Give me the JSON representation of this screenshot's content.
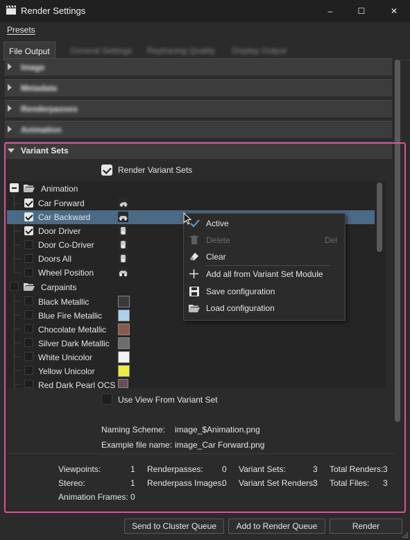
{
  "window": {
    "title": "Render Settings",
    "minimize": "–",
    "maximize": "☐",
    "close": "✕"
  },
  "menu": {
    "presets": "Presets"
  },
  "tabs": [
    "File Output",
    "General Settings",
    "Raytracing Quality",
    "Display Output"
  ],
  "sections": {
    "collapsed": [
      "Image",
      "Metadata",
      "Renderpasses",
      "Animation"
    ],
    "expanded": "Variant Sets"
  },
  "render_variant_sets": {
    "label": "Render Variant Sets",
    "checked": true
  },
  "tree": {
    "groups": [
      {
        "label": "Animation",
        "state": "partial",
        "items": [
          {
            "label": "Car Forward",
            "checked": true
          },
          {
            "label": "Car Backward",
            "checked": true,
            "selected": true
          },
          {
            "label": "Door Driver",
            "checked": true
          },
          {
            "label": "Door Co-Driver",
            "checked": false
          },
          {
            "label": "Doors All",
            "checked": false
          },
          {
            "label": "Wheel Position",
            "checked": false
          }
        ]
      },
      {
        "label": "Carpaints",
        "state": "unchecked",
        "items": [
          {
            "label": "Black Metallic",
            "checked": false,
            "swatch": "#3a3a3a"
          },
          {
            "label": "Blue Fire Metallic",
            "checked": false,
            "swatch": "#a9d2ea"
          },
          {
            "label": "Chocolate Metallic",
            "checked": false,
            "swatch": "#8a5a48"
          },
          {
            "label": "Silver Dark Metallic",
            "checked": false,
            "swatch": "#6d6d6d"
          },
          {
            "label": "White Unicolor",
            "checked": false,
            "swatch": "#f2f2f2"
          },
          {
            "label": "Yellow Unicolor",
            "checked": false,
            "swatch": "#f0ee3a"
          },
          {
            "label": "Red Dark Pearl OCS",
            "checked": false,
            "swatch": "#6e4a5e"
          }
        ]
      }
    ]
  },
  "context_menu": {
    "active": "Active",
    "delete": "Delete",
    "delete_shortcut": "Del",
    "clear": "Clear",
    "add_all": "Add all from Variant Set Module",
    "save": "Save configuration",
    "load": "Load configuration"
  },
  "use_view": {
    "label": "Use View From Variant Set",
    "checked": false
  },
  "naming": {
    "scheme_label": "Naming Scheme:",
    "scheme_value": "image_$Animation.png",
    "example_label": "Example file name:",
    "example_value": "image_Car Forward.png"
  },
  "stats": {
    "viewpoints_label": "Viewpoints:",
    "viewpoints": "1",
    "stereo_label": "Stereo:",
    "stereo": "1",
    "animation_frames_label": "Animation Frames:",
    "animation_frames": "0",
    "renderpasses_label": "Renderpasses:",
    "renderpasses": "0",
    "renderpass_images_label": "Renderpass Images:",
    "renderpass_images": "0",
    "variant_sets_label": "Variant Sets:",
    "variant_sets": "3",
    "variant_set_renders_label": "Variant Set Renders:",
    "variant_set_renders": "3",
    "total_renders_label": "Total Renders:",
    "total_renders": "3",
    "total_files_label": "Total Files:",
    "total_files": "3"
  },
  "buttons": {
    "send_cluster": "Send to Cluster Queue",
    "add_render_queue": "Add to Render Queue",
    "render": "Render"
  },
  "colors": {
    "highlight": "#e0509a",
    "selection": "#4b6a86",
    "accent": "#5aa0e6"
  }
}
